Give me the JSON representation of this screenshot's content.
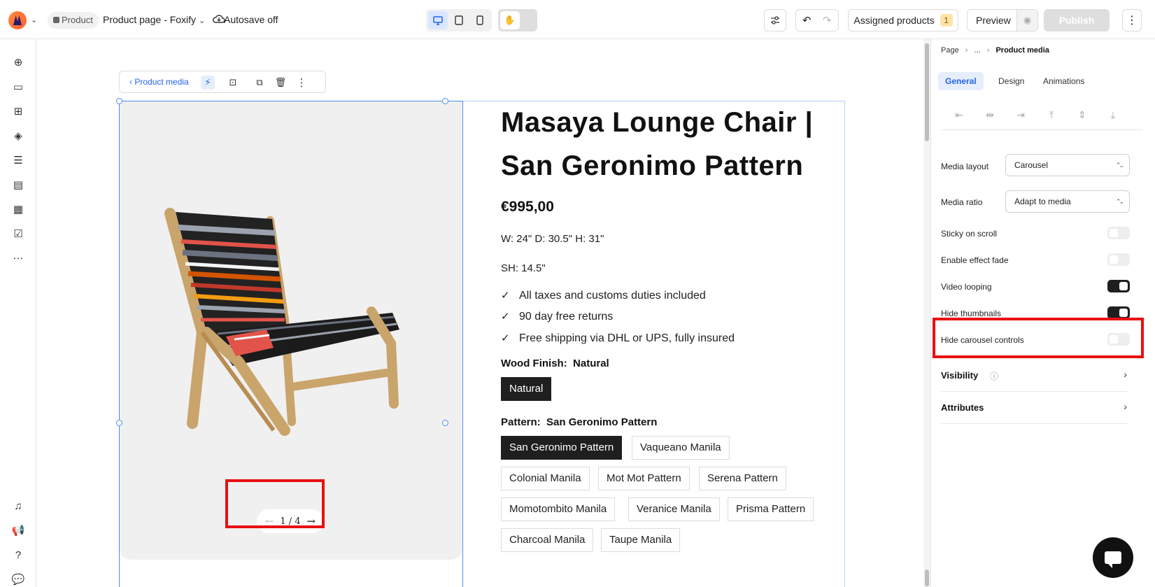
{
  "topbar": {
    "product_pill": "Product",
    "page_title": "Product page - Foxify",
    "autosave": "Autosave off",
    "assigned_products": "Assigned products",
    "assigned_count": "1",
    "preview": "Preview",
    "publish": "Publish"
  },
  "canvas": {
    "toolbar_back": "Product media",
    "carousel_counter": "1 / 4",
    "product": {
      "title": "Masaya Lounge Chair | San Geronimo Pattern",
      "price": "€995,00",
      "dimensions": "W: 24\" D: 30.5\" H: 31\"",
      "seat_height": "SH: 14.5\"",
      "features": [
        "All taxes and customs duties included",
        "90 day free returns",
        "Free shipping via DHL or UPS, fully insured"
      ],
      "wood_finish_label": "Wood Finish:",
      "wood_finish_value": "Natural",
      "wood_options": [
        "Natural"
      ],
      "pattern_label": "Pattern:",
      "pattern_value": "San Geronimo Pattern",
      "pattern_options": [
        "San Geronimo Pattern",
        "Vaqueano Manila",
        "Colonial Manila",
        "Mot Mot Pattern",
        "Serena Pattern",
        "Momotombito Manila",
        "Veranice Manila",
        "Prisma Pattern",
        "Charcoal Manila",
        "Taupe Manila"
      ]
    }
  },
  "panel": {
    "breadcrumb": [
      "Page",
      "...",
      "Product media"
    ],
    "tabs": [
      "General",
      "Design",
      "Animations"
    ],
    "active_tab": "General",
    "media_layout_label": "Media layout",
    "media_layout_value": "Carousel",
    "media_ratio_label": "Media ratio",
    "media_ratio_value": "Adapt to media",
    "toggles": [
      {
        "label": "Sticky on scroll",
        "on": false
      },
      {
        "label": "Enable effect fade",
        "on": false
      },
      {
        "label": "Video looping",
        "on": true
      },
      {
        "label": "Hide thumbnails",
        "on": true
      },
      {
        "label": "Hide carousel controls",
        "on": false
      }
    ],
    "sections": [
      "Visibility",
      "Attributes"
    ]
  },
  "colors": {
    "accent": "#2563eb",
    "highlight": "#e81010",
    "selected_chip": "#1f1f1f"
  }
}
